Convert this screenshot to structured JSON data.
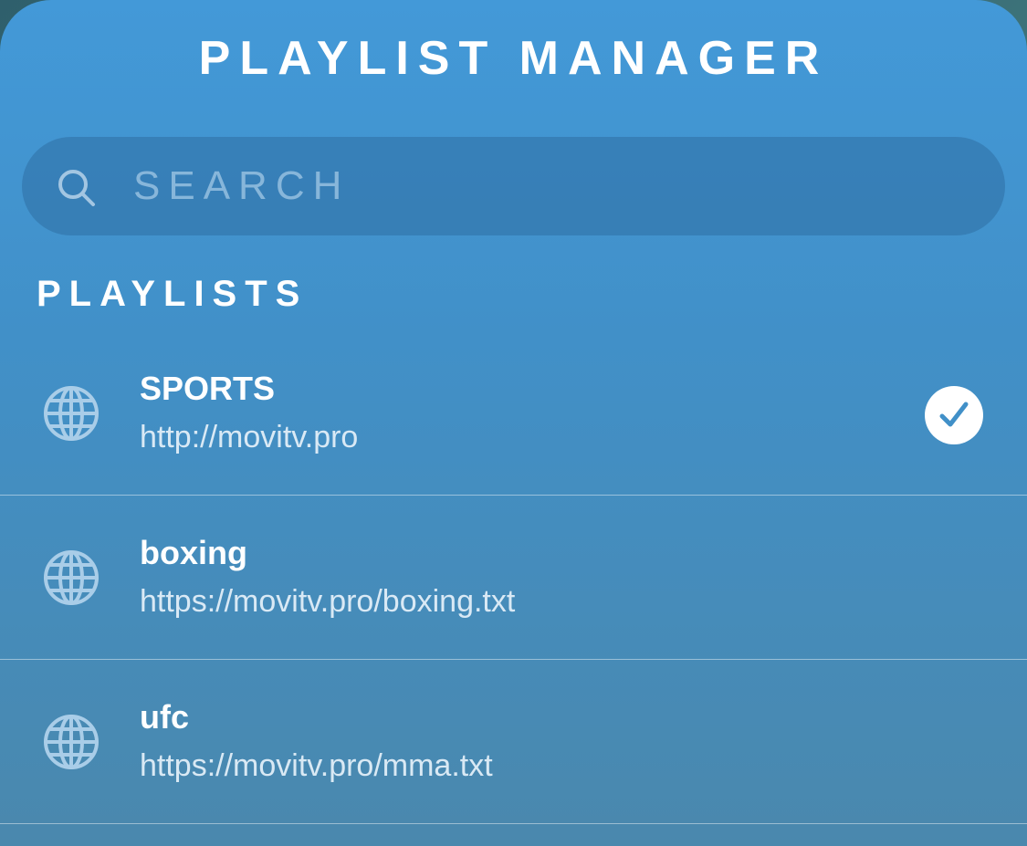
{
  "header": {
    "title": "PLAYLIST MANAGER"
  },
  "search": {
    "placeholder": "SEARCH",
    "value": "",
    "icon": "search-icon"
  },
  "section": {
    "label": "PLAYLISTS"
  },
  "playlists": [
    {
      "name": "SPORTS",
      "url": "http://movitv.pro",
      "icon": "globe-icon",
      "selected": true
    },
    {
      "name": "boxing",
      "url": "https://movitv.pro/boxing.txt",
      "icon": "globe-icon",
      "selected": false
    },
    {
      "name": "ufc",
      "url": "https://movitv.pro/mma.txt",
      "icon": "globe-icon",
      "selected": false
    }
  ],
  "colors": {
    "panel_top": "#4399d8",
    "panel_bottom": "#4a88ad",
    "text": "#ffffff",
    "check_mark": "#4190c8",
    "globe": "#a9cde8"
  }
}
